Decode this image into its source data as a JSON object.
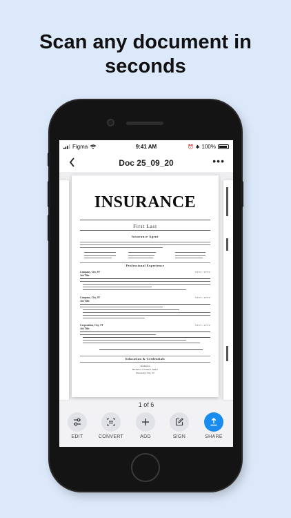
{
  "headline": "Scan any document in seconds",
  "status_bar": {
    "carrier": "Figma",
    "time": "9:41 AM",
    "battery": "100%"
  },
  "nav": {
    "title": "Doc 25_09_20",
    "back_icon": "chevron-left-icon",
    "more_icon": "ellipsis-icon"
  },
  "document": {
    "heading": "INSURANCE",
    "name": "First Last",
    "role": "Insurance Agent",
    "sections": [
      "Professional Experience",
      "Education & Credentials"
    ],
    "jobs": [
      {
        "company": "Company, City, ST",
        "title": "Job Title",
        "dates": "YYYY - YYYY"
      },
      {
        "company": "Company, City, ST",
        "title": "Job Title",
        "dates": "YYYY - YYYY"
      },
      {
        "company": "Corporation, City, ST",
        "title": "Job Title",
        "dates": "YYYY - YYYY"
      }
    ],
    "education": [
      "Institution",
      "Bachelor of Science, Major",
      "University, City, ST"
    ]
  },
  "pager": "1 of 6",
  "toolbar": [
    {
      "label": "EDIT",
      "icon": "sliders-icon",
      "primary": false
    },
    {
      "label": "CONVERT",
      "icon": "convert-icon",
      "primary": false
    },
    {
      "label": "ADD",
      "icon": "plus-icon",
      "primary": false
    },
    {
      "label": "SIGN",
      "icon": "sign-edit-icon",
      "primary": false
    },
    {
      "label": "SHARE",
      "icon": "share-upload-icon",
      "primary": true
    }
  ],
  "colors": {
    "background": "#dce9fb",
    "accent": "#1a8cf0",
    "tool_bg": "#e1e2e8"
  }
}
